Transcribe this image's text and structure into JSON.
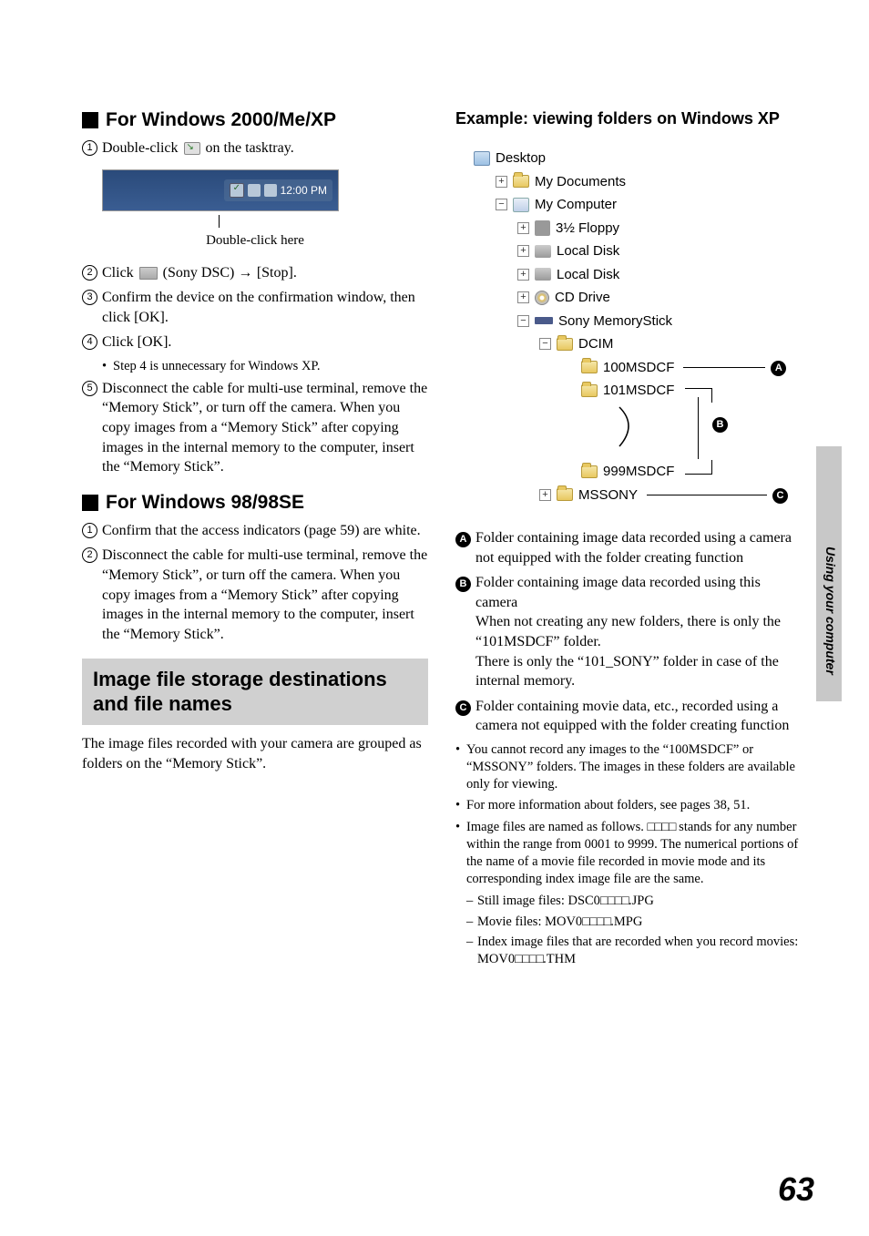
{
  "left": {
    "h1": "For Windows 2000/Me/XP",
    "s1": "Double-click",
    "s1b": "on the tasktray.",
    "taskbar_time": "12:00 PM",
    "taskbar_caption": "Double-click here",
    "s2a": "Click",
    "s2b": "(Sony DSC)",
    "s2c": "[Stop].",
    "s3": "Confirm the device on the confirmation window, then click [OK].",
    "s4": "Click [OK].",
    "s4_note": "Step 4 is unnecessary for Windows XP.",
    "s5": "Disconnect the cable for multi-use terminal, remove the “Memory Stick”, or turn off the camera. When you copy images from a “Memory Stick” after copying images in the internal memory to the computer, insert the “Memory Stick”.",
    "h2": "For Windows 98/98SE",
    "b1": "Confirm that the access indicators (page 59) are white.",
    "b2": "Disconnect the cable for multi-use terminal, remove the “Memory Stick”, or turn off the camera. When you copy images from a “Memory Stick” after copying images in the internal memory to the computer, insert the “Memory Stick”.",
    "gray_heading": "Image file storage destinations and file names",
    "gray_body": "The image files recorded with your camera are grouped as folders on the “Memory Stick”."
  },
  "right": {
    "example_heading": "Example: viewing folders on Windows XP",
    "tree": {
      "desktop": "Desktop",
      "mydocs": "My Documents",
      "mycomp": "My Computer",
      "floppy": "3½ Floppy",
      "local1": "Local Disk",
      "local2": "Local Disk",
      "cd": "CD Drive",
      "ms": "Sony MemoryStick",
      "dcim": "DCIM",
      "f100": "100MSDCF",
      "f101": "101MSDCF",
      "f999": "999MSDCF",
      "mssony": "MSSONY"
    },
    "A": "Folder containing image data recorded using a camera not equipped with the folder creating function",
    "B1": "Folder containing image data recorded using this camera",
    "B2": "When not creating any new folders, there is only the “101MSDCF” folder.",
    "B3": "There is only the “101_SONY” folder in case of the internal memory.",
    "C": "Folder containing movie data, etc., recorded using a camera not equipped with the folder creating function",
    "n1": "You cannot record any images to the “100MSDCF” or “MSSONY” folders. The images in these folders are available only for viewing.",
    "n2": "For more information about folders, see pages 38, 51.",
    "n3a": "Image files are named as follows. ",
    "n3b": " stands for any number within the range from 0001 to 9999. The numerical portions of the name of a movie file recorded in movie mode and its corresponding index image file are the same.",
    "s_still_a": "Still image files: DSC0",
    "s_still_b": ".JPG",
    "s_movie_a": "Movie files: MOV0",
    "s_movie_b": ".MPG",
    "s_thm_a": "Index image files that are recorded when you record movies: MOV0",
    "s_thm_b": ".THM"
  },
  "side": "Using your computer",
  "pagenum": "63"
}
